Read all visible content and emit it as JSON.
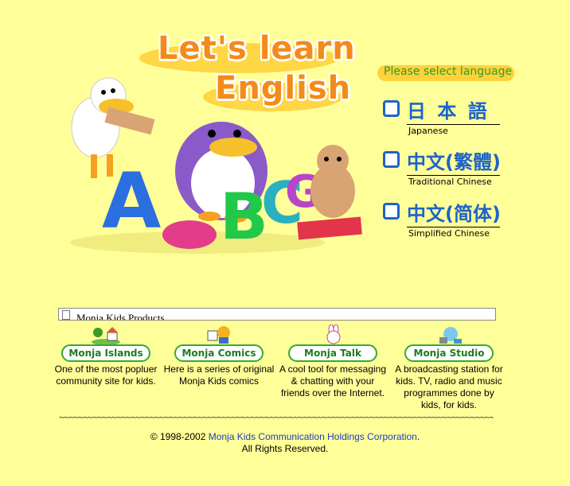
{
  "header": {
    "title_line1": "Let's learn",
    "title_line2": "English"
  },
  "language": {
    "prompt": "Please select language",
    "options": [
      {
        "native": "日 本 語",
        "english": "Japanese"
      },
      {
        "native": "中文(繁體)",
        "english": "Traditional Chinese"
      },
      {
        "native": "中文(简体)",
        "english": "Simplified Chinese"
      }
    ]
  },
  "products_bar": {
    "label": "Monja Kids Products"
  },
  "products": [
    {
      "name": "Monja Islands",
      "desc": "One of the most popluer community site for kids."
    },
    {
      "name": "Monja Comics",
      "desc": "Here is a series of original Monja Kids comics"
    },
    {
      "name": "Monja Talk",
      "desc": "A cool tool for messaging & chatting with your friends over the Internet."
    },
    {
      "name": "Monja Studio",
      "desc": "A broadcasting station for kids. TV, radio and music programmes done by kids, for kids."
    }
  ],
  "divider": "~~~~~~~~~~~~~~~~~~~~~~~~~~~~~~~~~~~~~~~~~~~~~~~~~~~~~~~~~~~~~~~~~~~~~~~~~~~~~~~~~~~~~~~~~~~~~~",
  "footer": {
    "copyright": "© 1998-2002 ",
    "company": "Monja Kids Communication Holdings Corporation",
    "period": ".",
    "rights": "All Rights Reserved."
  },
  "colors": {
    "background": "#ffff99",
    "title": "#f38a1c",
    "link_blue": "#1e64c8",
    "green": "#2c9d2c"
  }
}
